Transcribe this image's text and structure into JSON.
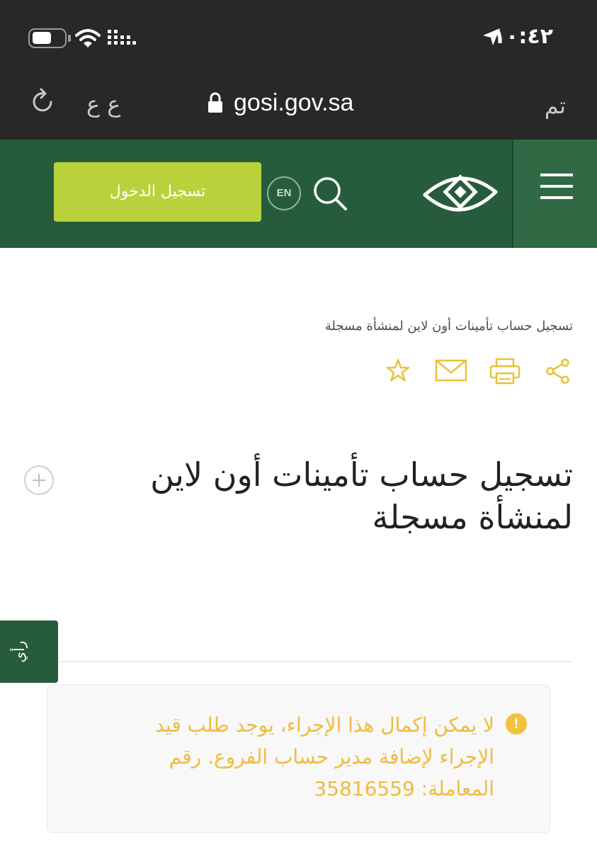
{
  "status_bar": {
    "time": "١٠:٤٢"
  },
  "browser": {
    "done_label": "تم",
    "url": "gosi.gov.sa",
    "text_size_label": "ع ع"
  },
  "header": {
    "login_label": "تسجيل الدخول",
    "lang_label": "EN",
    "brand_color": "#265c3b",
    "accent_color": "#b9d23c"
  },
  "content": {
    "breadcrumb": "تسجيل حساب تأمينات أون لاين لمنشأة مسجلة",
    "title": "تسجيل حساب تأمينات أون لاين لمنشأة مسجلة",
    "action_icons": [
      "share-icon",
      "print-icon",
      "mail-icon",
      "star-icon"
    ],
    "action_color": "#e8c23a"
  },
  "feedback": {
    "label": "رأي"
  },
  "alert": {
    "icon": "!",
    "message": "لا يمكن إكمال هذا الإجراء، يوجد طلب قيد الإجراء لإضافة مدير حساب الفروع. رقم المعاملة: 35816559",
    "text_color": "#efbb3e"
  }
}
